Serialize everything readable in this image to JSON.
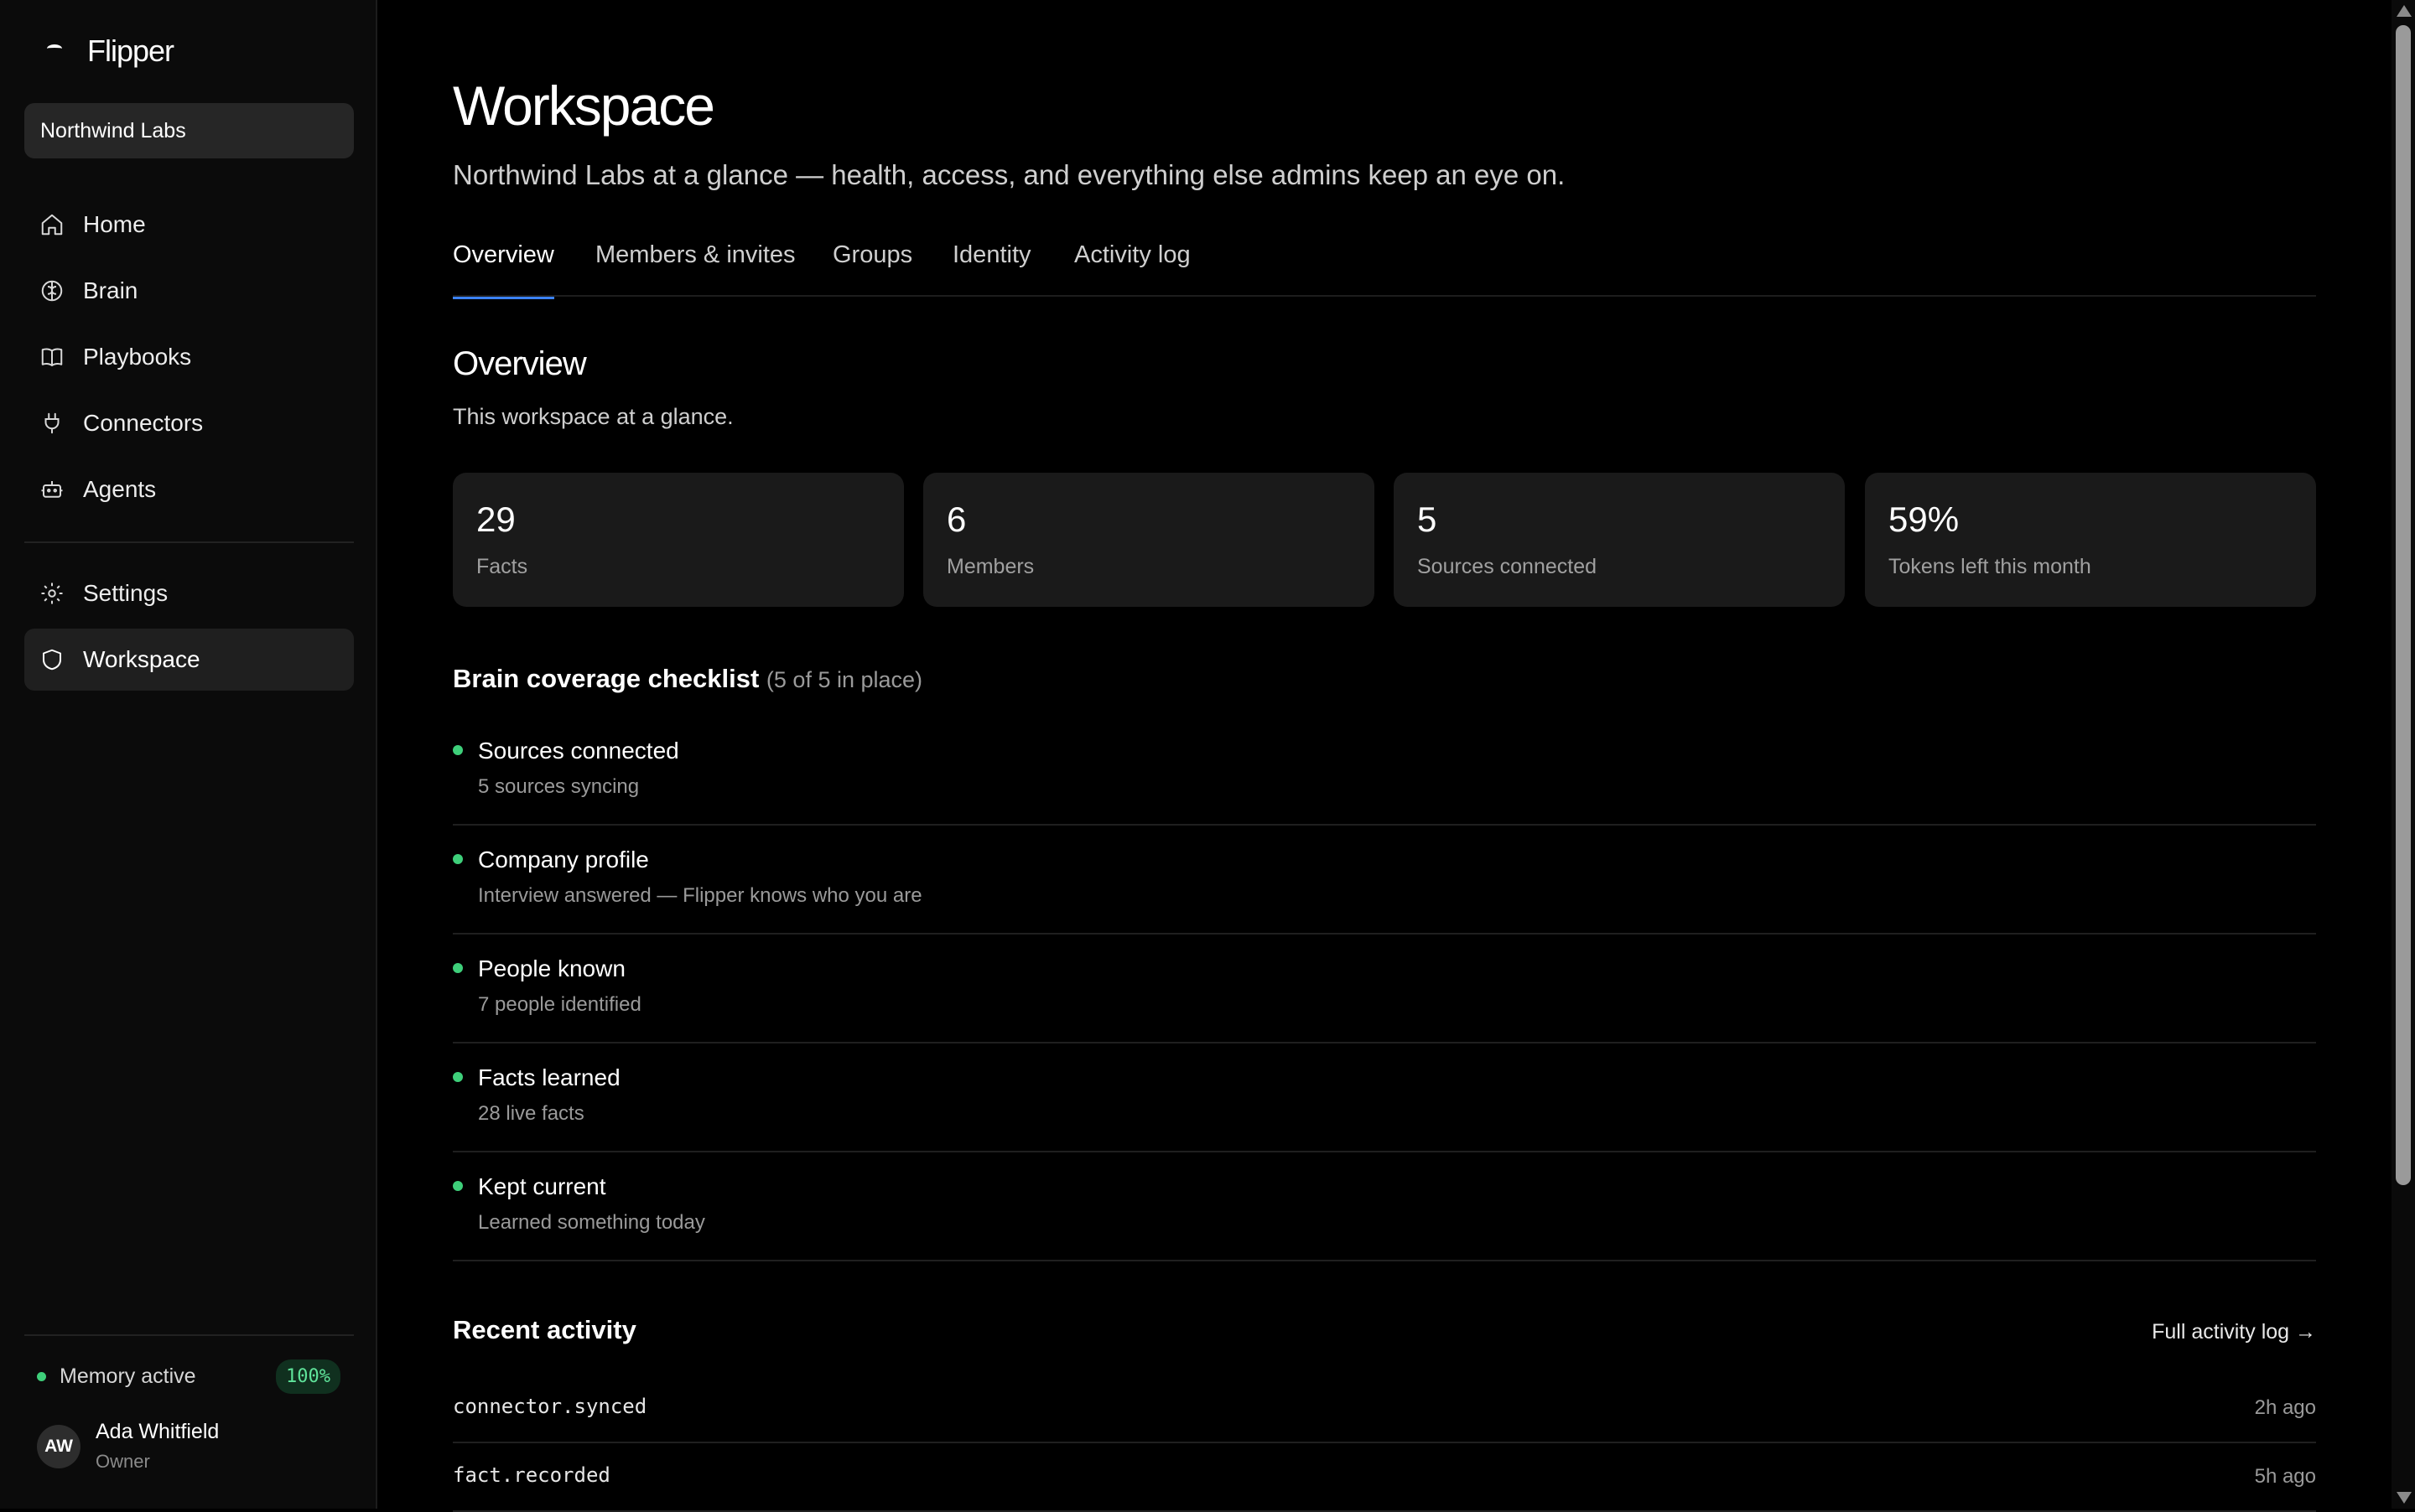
{
  "app": {
    "name": "Flipper"
  },
  "workspace_switcher": {
    "label": "Northwind Labs"
  },
  "sidebar": {
    "primary": [
      {
        "label": "Home",
        "icon": "home-icon"
      },
      {
        "label": "Brain",
        "icon": "brain-icon"
      },
      {
        "label": "Playbooks",
        "icon": "book-icon"
      },
      {
        "label": "Connectors",
        "icon": "plug-icon"
      },
      {
        "label": "Agents",
        "icon": "robot-icon"
      }
    ],
    "secondary": [
      {
        "label": "Settings",
        "icon": "gear-icon"
      },
      {
        "label": "Workspace",
        "icon": "shield-icon",
        "active": true
      }
    ],
    "memory": {
      "label": "Memory active",
      "percent": "100%"
    },
    "user": {
      "initials": "AW",
      "name": "Ada Whitfield",
      "role": "Owner"
    }
  },
  "header": {
    "title": "Workspace",
    "subtitle": "Northwind Labs at a glance — health, access, and everything else admins keep an eye on."
  },
  "tabs": [
    {
      "label": "Overview",
      "active": true
    },
    {
      "label": "Members & invites"
    },
    {
      "label": "Groups"
    },
    {
      "label": "Identity"
    },
    {
      "label": "Activity log"
    }
  ],
  "overview": {
    "title": "Overview",
    "subtitle": "This workspace at a glance.",
    "stats": [
      {
        "value": "29",
        "label": "Facts"
      },
      {
        "value": "6",
        "label": "Members"
      },
      {
        "value": "5",
        "label": "Sources connected"
      },
      {
        "value": "59%",
        "label": "Tokens left this month"
      }
    ]
  },
  "checklist": {
    "title": "Brain coverage checklist",
    "count": "(5 of 5 in place)",
    "items": [
      {
        "title": "Sources connected",
        "desc": "5 sources syncing"
      },
      {
        "title": "Company profile",
        "desc": "Interview answered — Flipper knows who you are"
      },
      {
        "title": "People known",
        "desc": "7 people identified"
      },
      {
        "title": "Facts learned",
        "desc": "28 live facts"
      },
      {
        "title": "Kept current",
        "desc": "Learned something today"
      }
    ]
  },
  "activity": {
    "title": "Recent activity",
    "link": "Full activity log →",
    "rows": [
      {
        "event": "connector.synced",
        "time": "2h ago"
      },
      {
        "event": "fact.recorded",
        "time": "5h ago"
      }
    ]
  },
  "colors": {
    "accent": "#3b82f6",
    "success": "#3ecf7a",
    "background": "#000000"
  }
}
